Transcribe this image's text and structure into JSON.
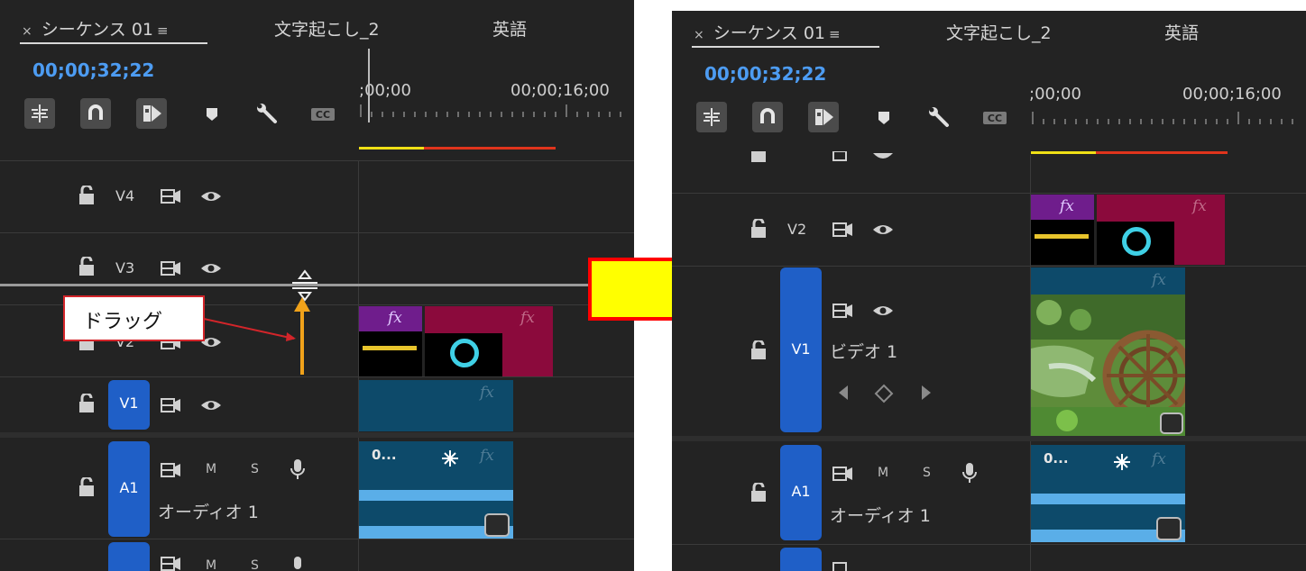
{
  "tabs": {
    "close": "×",
    "menu": "≡",
    "active": "シーケンス 01",
    "second": "文字起こし_2",
    "third": "英語"
  },
  "timecode": "00;00;32;22",
  "ruler": {
    "start": ";00;00",
    "mid": "00;00;16;00"
  },
  "tracks": {
    "v4": "V4",
    "v3": "V3",
    "v2": "V2",
    "v1": "V1",
    "a1": "A1",
    "m": "M",
    "s": "S",
    "audio_name": "オーディオ 1",
    "video_name": "ビデオ 1"
  },
  "clips": {
    "fx": "fx",
    "audio_title": "0..."
  },
  "callout": "ドラッグ",
  "colors": {
    "panel_bg": "#232323",
    "timecode": "#4d9cf2",
    "track_tag": "#1f5fc7",
    "purple_clip": "#6f1d8c",
    "crimson_clip": "#8b0a3c",
    "teal_clip": "#0d4a6a",
    "waveform": "#5aaee8",
    "work_bar_yellow": "#f0e016",
    "work_bar_red": "#e0341c",
    "arrow_yellow": "#ffff00",
    "arrow_red": "#ff0000",
    "drag_arrow": "#f0a21a"
  }
}
